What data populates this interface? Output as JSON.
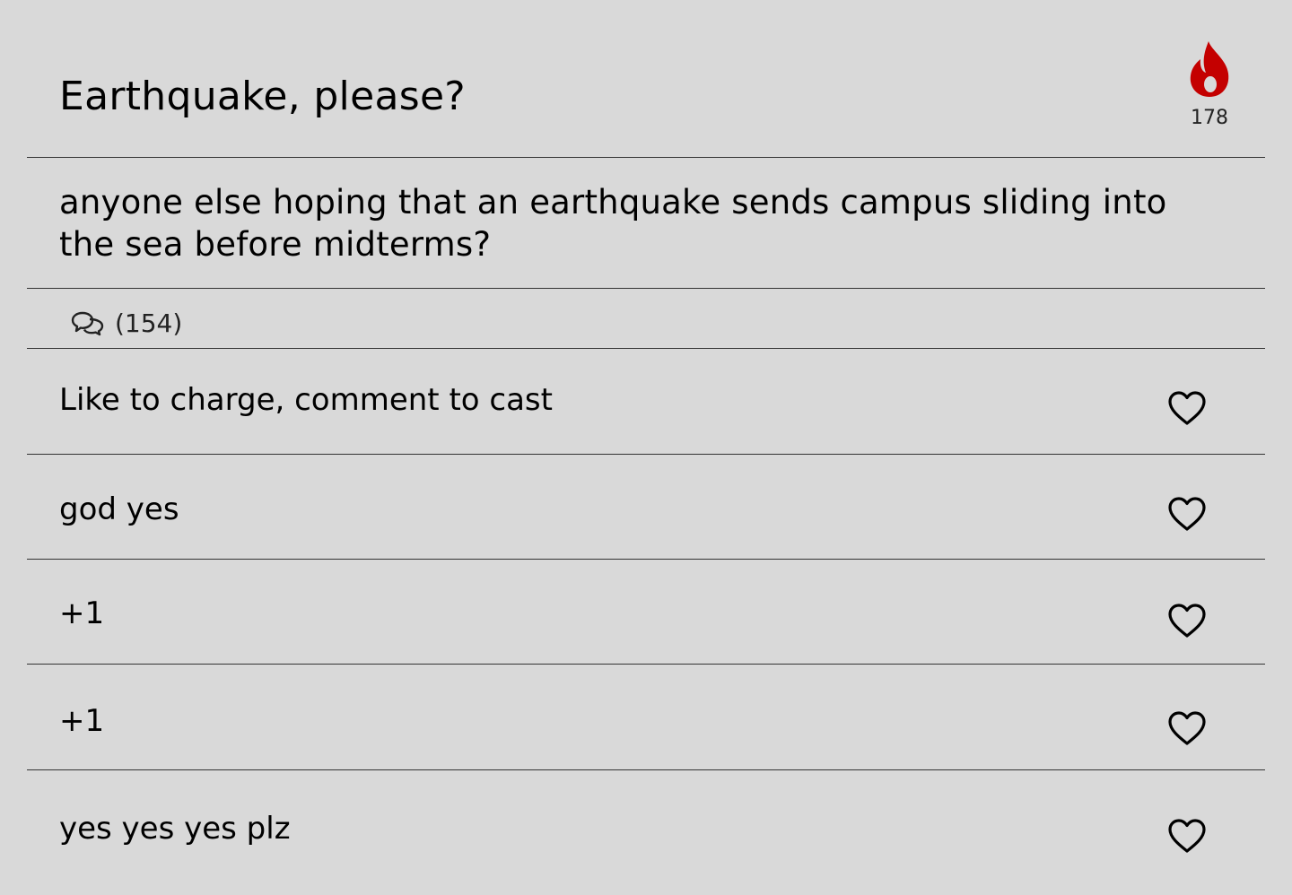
{
  "post": {
    "title": "Earthquake, please?",
    "body": "anyone else hoping that an earthquake sends campus sliding into the sea before midterms?",
    "heat_count": "178",
    "heat_icon": "flame-icon",
    "heat_color": "#c40000",
    "comments_icon": "chat-bubbles-icon",
    "comments_count": "(154)"
  },
  "comments": [
    {
      "text": "Like to charge, comment to cast",
      "like_icon": "heart-outline-icon"
    },
    {
      "text": "god yes",
      "like_icon": "heart-outline-icon"
    },
    {
      "text": "+1",
      "like_icon": "heart-outline-icon"
    },
    {
      "text": "+1",
      "like_icon": "heart-outline-icon"
    },
    {
      "text": "yes yes yes plz",
      "like_icon": "heart-outline-icon"
    }
  ],
  "colors": {
    "background": "#d9d9d9",
    "divider": "#333333",
    "text": "#000000"
  }
}
